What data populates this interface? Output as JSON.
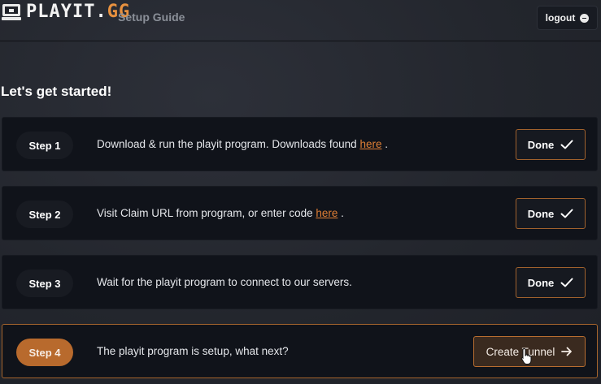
{
  "header": {
    "logo_text_main": "PLAYIT.",
    "logo_text_accent": "GG",
    "nav_title": "Setup Guide",
    "logout_label": "logout"
  },
  "main": {
    "heading": "Let's get started!",
    "steps": [
      {
        "badge": "Step 1",
        "text_before": "Download & run the playit program. Downloads found ",
        "link": "here",
        "text_after": " .",
        "button": "Done"
      },
      {
        "badge": "Step 2",
        "text_before": "Visit Claim URL from program, or enter code ",
        "link": "here",
        "text_after": " .",
        "button": "Done"
      },
      {
        "badge": "Step 3",
        "text_before": "Wait for the playit program to connect to our servers.",
        "button": "Done"
      },
      {
        "badge": "Step 4",
        "text_before": "The playit program is setup, what next?",
        "button": "Create Tunnel"
      }
    ]
  },
  "colors": {
    "accent": "#e8913f",
    "link": "#e07f35",
    "active_badge": "#b86a2d",
    "card_bg": "#10131a"
  },
  "icons": {
    "logo": "computer-icon",
    "logout": "minus-circle-icon",
    "done": "check-icon",
    "create": "arrow-right-icon"
  }
}
